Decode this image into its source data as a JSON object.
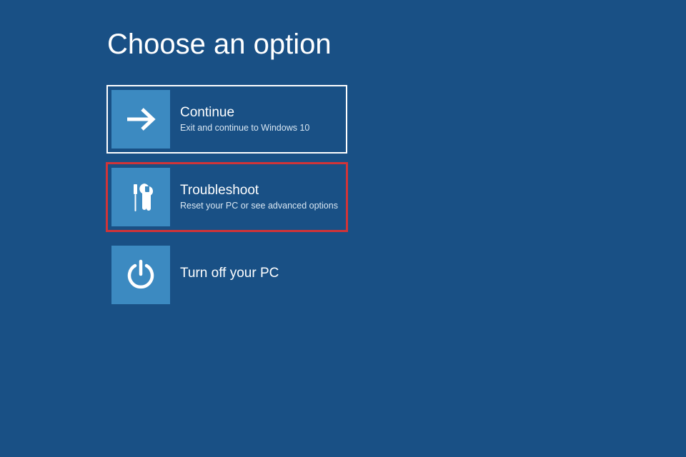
{
  "page_title": "Choose an option",
  "options": [
    {
      "id": "continue",
      "title": "Continue",
      "subtitle": "Exit and continue to Windows 10",
      "icon": "arrow-right",
      "state": "selected"
    },
    {
      "id": "troubleshoot",
      "title": "Troubleshoot",
      "subtitle": "Reset your PC or see advanced options",
      "icon": "tools",
      "state": "highlighted"
    },
    {
      "id": "power-off",
      "title": "Turn off your PC",
      "subtitle": "",
      "icon": "power",
      "state": "none"
    }
  ],
  "colors": {
    "background": "#195085",
    "tile_icon_bg": "#3c8ac1",
    "selected_outline": "#ffffff",
    "highlight_outline": "#d13438"
  }
}
